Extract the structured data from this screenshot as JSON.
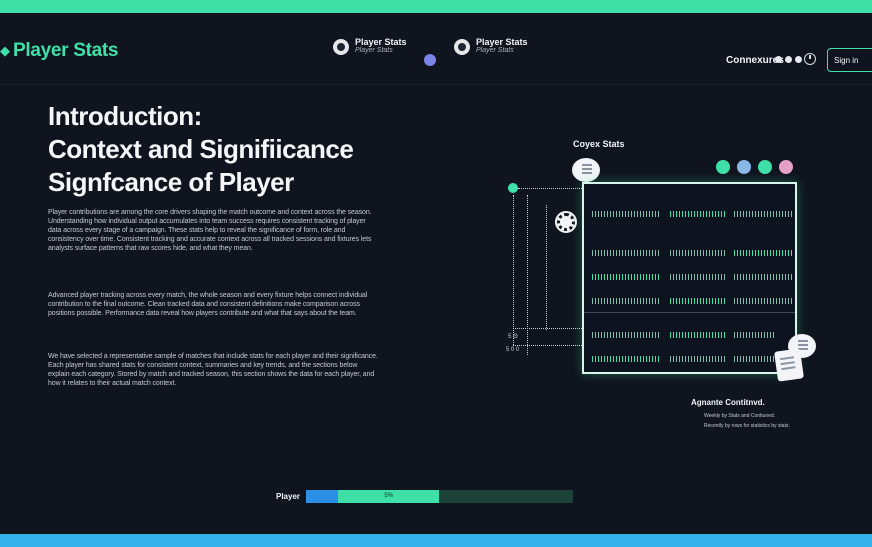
{
  "header": {
    "logo_text": "Player Stats",
    "nav_brand_1": {
      "title": "Player Stats",
      "subtitle": "Player Stats"
    },
    "nav_brand_2": {
      "title": "Player Stats",
      "subtitle": "Player Stats"
    },
    "connectors_label": "Connexures",
    "signin_label": "Sign in"
  },
  "main": {
    "heading_line1": "Introduction:",
    "heading_line2": "Context and Signifiicance",
    "heading_line3": "Signfcance of Player",
    "paragraph1": "Player contributions are among the core drivers shaping the match outcome and context across the season. Understanding how individual output accumulates into team success requires consistent tracking of player data across every stage of a campaign. These stats help to reveal the significance of form, role and consistency over time. Consistent tracking and accurate context across all tracked sessions and fixtures lets analysts surface patterns that raw scores hide, and what they mean.",
    "paragraph2": "Advanced player tracking across every match, the whole season and every fixture helps connect individual contribution to the final outcome. Clean tracked data and consistent definitions make comparison across positions possible. Performance data reveal how players contribute and what that says about the team.",
    "paragraph3": "We have selected a representative sample of matches that include stats for each player and their significance. Each player has shared stats for consistent context, summaries and key trends, and the sections below explain each category. Stored by match and tracked season, this section shows the data for each player, and how it relates to their actual match context."
  },
  "figure": {
    "title": "Coyex Stats",
    "icon_colors": [
      "#3fe0a8",
      "#8ab8e6",
      "#3fe0a8",
      "#e6a0c8"
    ],
    "axis_labels": [
      "5 Θ",
      "5 0 0"
    ],
    "aggregate_title": "Agnante Contitnvd.",
    "aggregate_lines": [
      "Weekly by Stats and Contiuned.",
      "Recently by rows for statistics by stats."
    ]
  },
  "progress": {
    "label": "Player",
    "segment_text": "5%",
    "segments": [
      0.12,
      0.38,
      0.5
    ]
  },
  "colors": {
    "accent": "#3fe0a8",
    "secondary": "#33b3ea",
    "background": "#0f141e"
  }
}
